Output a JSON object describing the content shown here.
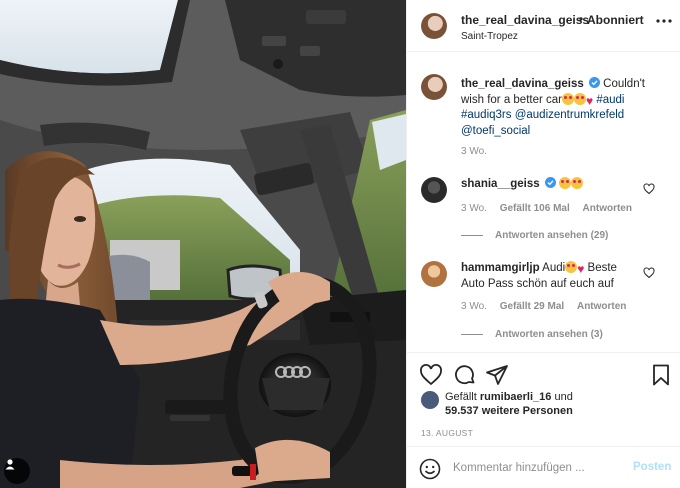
{
  "post": {
    "username": "the_real_davina_geiss",
    "separator": "•",
    "follow_label": "Abonniert",
    "location": "Saint-Tropez"
  },
  "caption": {
    "username": "the_real_davina_geiss",
    "text_lead": "Couldn't wish for a better car",
    "tags": [
      "#audi",
      "#audiq3rs",
      "@audizentrumkrefeld",
      "@toefi_social"
    ],
    "time": "3 Wo."
  },
  "comments": [
    {
      "username": "shania__geiss",
      "verified": true,
      "text": "",
      "time": "3 Wo.",
      "likes": "Gefällt 106 Mal",
      "reply_label": "Antworten",
      "view_replies": "Antworten ansehen (29)"
    },
    {
      "username": "hammamgirljp",
      "verified": false,
      "text_lead": "Audi",
      "text_tail": "Beste Auto Pass schön auf euch auf",
      "time": "3 Wo.",
      "likes": "Gefällt 29 Mal",
      "reply_label": "Antworten",
      "view_replies": "Antworten ansehen (3)"
    }
  ],
  "likes": {
    "prefix": "Gefällt",
    "user": "rumibaerli_16",
    "connector": "und",
    "others": "59.537 weitere Personen"
  },
  "date": "13. AUGUST",
  "comment_input": {
    "placeholder": "Kommentar hinzufügen ...",
    "post_label": "Posten"
  },
  "icons": {
    "verified": "verified-badge-icon",
    "like": "heart-icon",
    "comment": "comment-icon",
    "share": "paper-plane-icon",
    "save": "bookmark-icon",
    "more": "more-options-icon",
    "emoji": "smiley-icon",
    "tagged": "user-tag-icon"
  },
  "colors": {
    "link": "#00376b",
    "verified": "#3897f0",
    "secondary_text": "#8e8e8e",
    "post_disabled": "#b2dffc"
  }
}
